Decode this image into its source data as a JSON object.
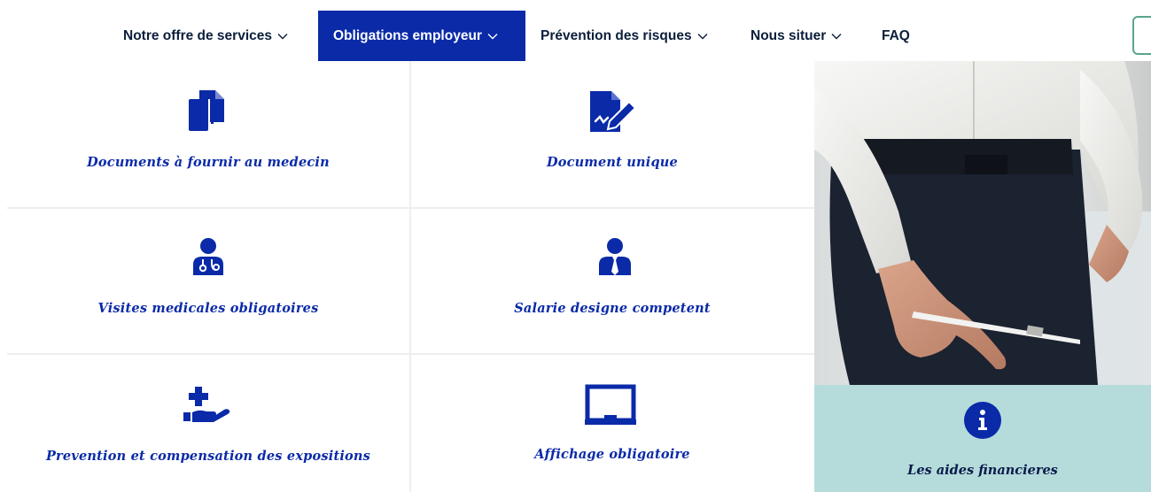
{
  "nav": {
    "items": [
      {
        "label": "Notre offre de services",
        "has_dropdown": true
      },
      {
        "label": "Obligations employeur",
        "has_dropdown": true,
        "active": true
      },
      {
        "label": "Prévention des risques",
        "has_dropdown": true
      },
      {
        "label": "Nous situer",
        "has_dropdown": true
      },
      {
        "label": "FAQ",
        "has_dropdown": false
      }
    ]
  },
  "tiles": [
    {
      "label": "Documents à fournir au medecin",
      "icon": "copy-documents-icon"
    },
    {
      "label": "Document unique",
      "icon": "document-signature-icon"
    },
    {
      "label": "Visites medicales obligatoires",
      "icon": "doctor-icon"
    },
    {
      "label": "Salarie designe competent",
      "icon": "employee-tie-icon"
    },
    {
      "label": "Prevention et compensation des expositions",
      "icon": "hand-medical-icon"
    },
    {
      "label": "Affichage obligatoire",
      "icon": "display-board-icon"
    }
  ],
  "aid_card": {
    "label": "Les aides financieres",
    "icon": "info-circle-icon"
  },
  "photo": {
    "icon": "businessman-photo"
  },
  "colors": {
    "brand_blue": "#0a2aa8",
    "aid_card_bg": "#b5dcdb",
    "nav_text": "#0b1e3a"
  }
}
